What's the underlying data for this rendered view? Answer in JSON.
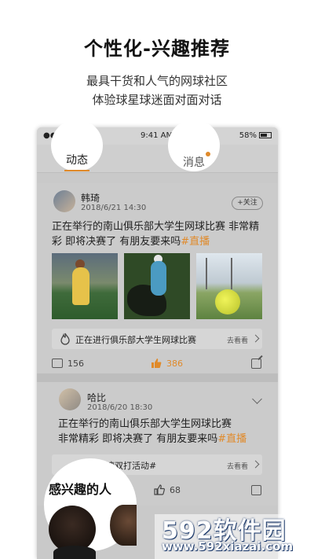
{
  "header": {
    "title": "个性化-兴趣推荐",
    "subtitle_line1": "最具干货和人气的网球社区",
    "subtitle_line2": "体验球星球迷面对面对话"
  },
  "status_bar": {
    "carrier": "●●●○○ GS",
    "time": "9:41 AM",
    "battery": "58%"
  },
  "tabs": {
    "dynamic": "动态",
    "messages": "消息"
  },
  "posts": [
    {
      "username": "韩琦",
      "date": "2018/6/21 14:30",
      "follow_label": "+关注",
      "text": "正在举行的南山俱乐部大学生网球比赛 非常精彩 即将决赛了 有朋友要来吗",
      "hashtag": "#直播",
      "live_bar_text": "正在进行俱乐部大学生网球比赛",
      "live_bar_link": "去看看",
      "comments": "156",
      "likes": "386"
    },
    {
      "username": "哈比",
      "date": "2018/6/20 18:30",
      "text_line1": "正在举行的南山俱乐部大学生网球比赛",
      "text_line2": "非常精彩 即将决赛了 有朋友要来吗",
      "hashtag": "#直播",
      "event_bar_text": "海湾双打活动#",
      "event_bar_link": "去看看",
      "likes": "68"
    }
  ],
  "interest": {
    "label": "感兴趣的人"
  },
  "watermark": {
    "brand": "592软件园",
    "url": "www.592xiazai.com"
  },
  "colors": {
    "accent": "#e08a2a",
    "overlay": "#c9c9c9"
  }
}
